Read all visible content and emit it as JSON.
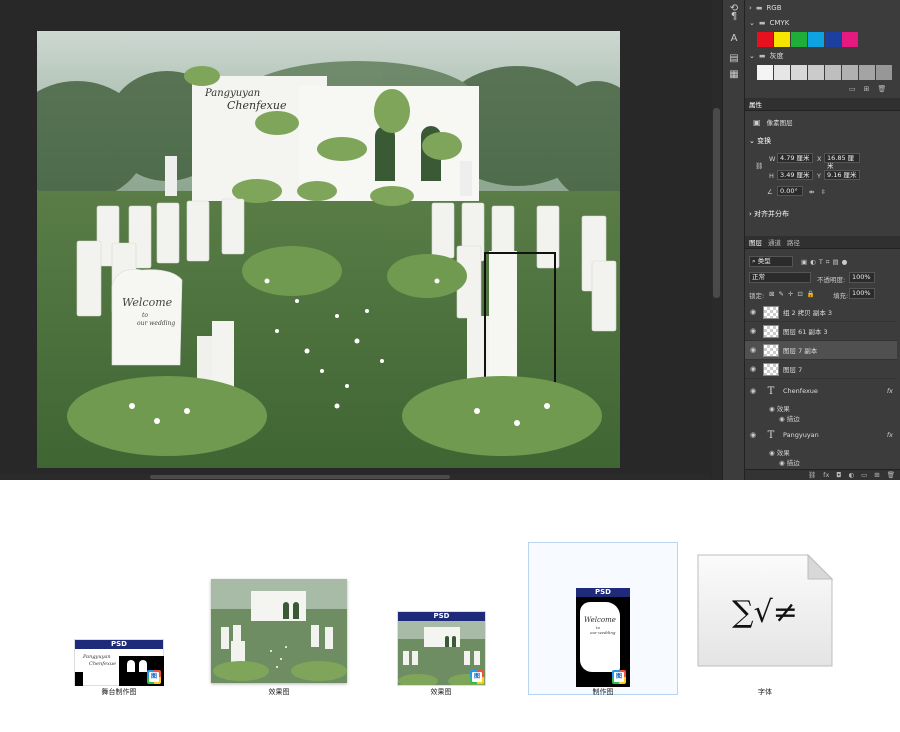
{
  "swatch_panel": {
    "groups": [
      {
        "name": "RGB"
      },
      {
        "name": "CMYK",
        "colors": [
          "#e8101e",
          "#f5e500",
          "#1fae3a",
          "#0ea2e0",
          "#1c3fa0",
          "#e5197f"
        ]
      },
      {
        "name": "灰度",
        "colors": [
          "#f4f4f4",
          "#e6e6e6",
          "#d8d8d8",
          "#cbcbcb",
          "#bebebe",
          "#b1b1b1",
          "#a4a4a4",
          "#979797"
        ]
      }
    ]
  },
  "properties": {
    "tab_label": "属性",
    "layer_type": "像素图层",
    "transform_label": "变换",
    "w_label": "W",
    "w_value": "4.79 厘米",
    "x_label": "X",
    "x_value": "16.85 厘米",
    "h_label": "H",
    "h_value": "3.49 厘米",
    "y_label": "Y",
    "y_value": "9.16 厘米",
    "angle_value": "0.00°",
    "align_label": "对齐并分布"
  },
  "layers_panel": {
    "tabs": [
      "图层",
      "通道",
      "路径"
    ],
    "filter_kind": "类型",
    "blend_mode": "正常",
    "opacity_label": "不透明度:",
    "opacity_value": "100%",
    "lock_label": "锁定:",
    "fill_label": "填充:",
    "fill_value": "100%",
    "layers": [
      {
        "name": "组 2 拷贝 副本 3",
        "type": "pixel",
        "selected": false
      },
      {
        "name": "图层 61 副本 3",
        "type": "pixel",
        "selected": false
      },
      {
        "name": "图层 7 副本",
        "type": "pixel",
        "selected": true
      },
      {
        "name": "图层 7",
        "type": "pixel",
        "selected": false
      },
      {
        "name": "Chenfexue",
        "type": "text",
        "fx": "fx",
        "effects_label": "效果",
        "effect": "描边"
      },
      {
        "name": "Pangyuyan",
        "type": "text",
        "fx": "fx",
        "effects_label": "效果",
        "effect": "描边"
      }
    ]
  },
  "artboard": {
    "script_line1": "Pangyuyan",
    "script_line2": "Chenfexue",
    "welcome": "Welcome",
    "to": "to",
    "our_wedding": "our wedding"
  },
  "files": [
    {
      "caption": "舞台制作图",
      "badge": "PSD",
      "line1": "Pangyuyan",
      "line2": "Chenfexue"
    },
    {
      "caption": "效果图"
    },
    {
      "caption": "效果图",
      "badge": "PSD"
    },
    {
      "caption": "制作图",
      "badge": "PSD",
      "welcome": "Welcome",
      "to": "to",
      "our_wedding": "our wedding"
    },
    {
      "caption": "字体",
      "glyphs": "∑√≠"
    }
  ]
}
